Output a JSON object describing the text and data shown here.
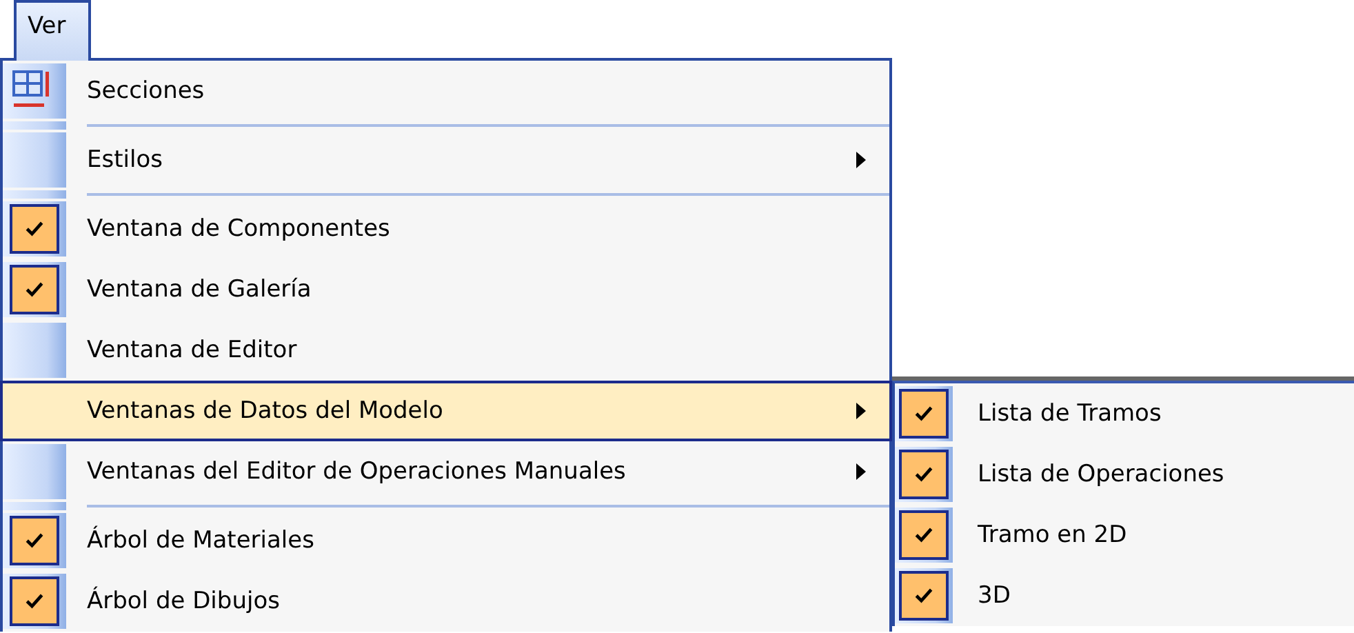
{
  "menu_bar": {
    "title": "Ver",
    "open": true
  },
  "menu": {
    "items": [
      {
        "kind": "item",
        "label": "Secciones",
        "icon": true,
        "checked": false,
        "selected": false,
        "has_submenu": false
      },
      {
        "kind": "separator"
      },
      {
        "kind": "item",
        "label": "Estilos",
        "checked": false,
        "selected": false,
        "has_submenu": true
      },
      {
        "kind": "separator"
      },
      {
        "kind": "item",
        "label": "Ventana de Componentes",
        "checked": true,
        "selected": false,
        "has_submenu": false
      },
      {
        "kind": "item",
        "label": "Ventana de Galería",
        "checked": true,
        "selected": false,
        "has_submenu": false
      },
      {
        "kind": "item",
        "label": "Ventana de Editor",
        "checked": false,
        "selected": false,
        "has_submenu": false
      },
      {
        "kind": "item",
        "label": "Ventanas de Datos del Modelo",
        "checked": false,
        "selected": true,
        "has_submenu": true
      },
      {
        "kind": "item",
        "label": "Ventanas del Editor de Operaciones Manuales",
        "checked": false,
        "selected": false,
        "has_submenu": true
      },
      {
        "kind": "separator"
      },
      {
        "kind": "item",
        "label": "Árbol de Materiales",
        "checked": true,
        "selected": false,
        "has_submenu": false
      },
      {
        "kind": "item",
        "label": "Árbol de Dibujos",
        "checked": true,
        "selected": false,
        "has_submenu": false
      }
    ]
  },
  "submenu": {
    "items": [
      {
        "kind": "item",
        "label": "Lista de Tramos",
        "checked": true,
        "selected": false,
        "has_submenu": false
      },
      {
        "kind": "item",
        "label": "Lista de Operaciones",
        "checked": true,
        "selected": false,
        "has_submenu": false
      },
      {
        "kind": "item",
        "label": "Tramo en 2D",
        "checked": true,
        "selected": false,
        "has_submenu": false
      },
      {
        "kind": "item",
        "label": "3D",
        "checked": true,
        "selected": false,
        "has_submenu": false
      }
    ]
  }
}
